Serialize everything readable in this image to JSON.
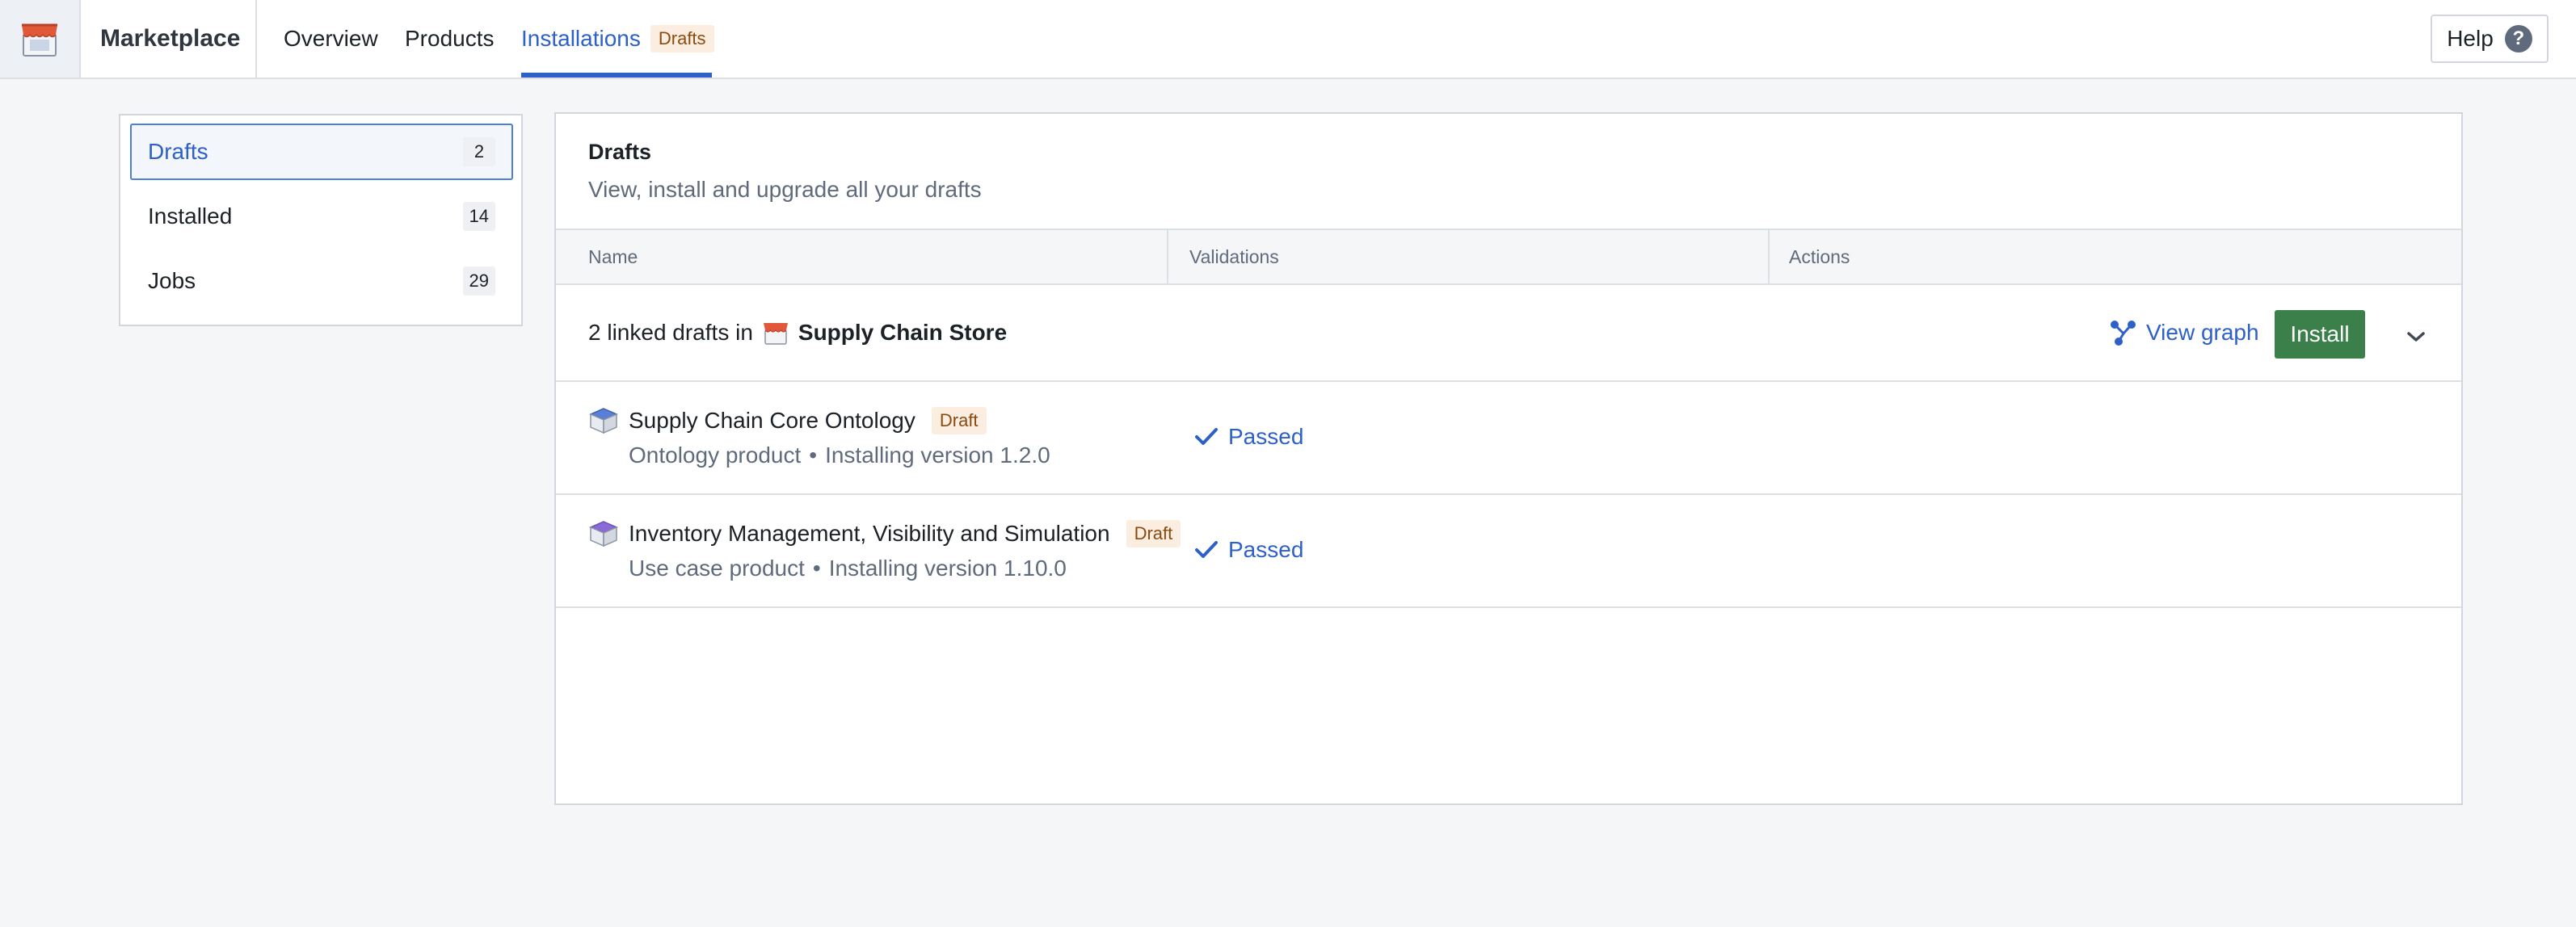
{
  "app": {
    "name": "Marketplace",
    "logo_icon": "store-icon"
  },
  "nav": {
    "overview": "Overview",
    "products": "Products",
    "installations": "Installations",
    "installations_tag": "Drafts"
  },
  "help": {
    "label": "Help",
    "icon_glyph": "?"
  },
  "sidebar": {
    "items": [
      {
        "label": "Drafts",
        "count": "2",
        "active": true
      },
      {
        "label": "Installed",
        "count": "14",
        "active": false
      },
      {
        "label": "Jobs",
        "count": "29",
        "active": false
      }
    ]
  },
  "panel": {
    "title": "Drafts",
    "subtitle": "View, install and upgrade all your drafts",
    "columns": [
      "Name",
      "Validations",
      "Actions"
    ],
    "group": {
      "prefix": "2 linked drafts in",
      "store_name": "Supply Chain Store",
      "store_icon": "store-icon",
      "view_graph": "View graph",
      "view_graph_icon": "graph-icon",
      "install": "Install",
      "expand_icon": "chevron-down-icon"
    },
    "drafts": [
      {
        "name": "Supply Chain Core Ontology",
        "tag": "Draft",
        "type": "Ontology product",
        "bullet": "•",
        "version": "Installing version 1.2.0",
        "validation": "Passed",
        "icon": "product-box-icon"
      },
      {
        "name": "Inventory Management, Visibility and Simulation",
        "tag": "Draft",
        "type": "Use case product",
        "bullet": "•",
        "version": "Installing version 1.10.0",
        "validation": "Passed",
        "icon": "product-box-icon"
      }
    ]
  },
  "colors": {
    "accent": "#2d60c8",
    "install_button": "#3b7f4a",
    "draft_tag_bg": "#fbeee0",
    "draft_tag_text": "#8a4b12",
    "store_icon": "#e0573a"
  }
}
